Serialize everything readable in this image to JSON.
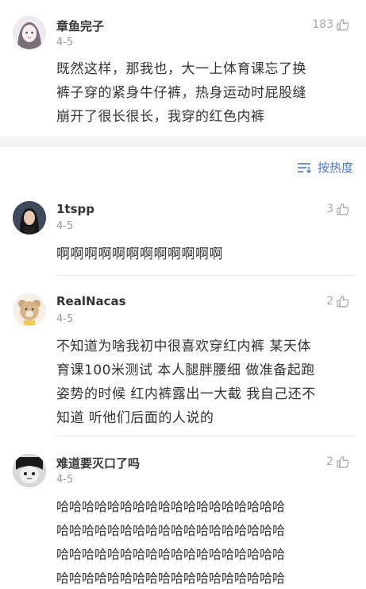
{
  "main_comment": {
    "username": "章鱼完子",
    "date": "4-5",
    "likes": "183",
    "lines": [
      "既然这样，那我也，大一上体育课忘了换",
      "裤子穿的紧身牛仔裤，热身运动时屁股缝",
      "崩开了很长很长，我穿的红色内裤"
    ]
  },
  "sort": {
    "label": "按热度",
    "icon": "sort-icon"
  },
  "replies": [
    {
      "username": "1tspp",
      "date": "4-5",
      "likes": "3",
      "lines": [
        "啊啊啊啊啊啊啊啊啊啊啊啊"
      ]
    },
    {
      "username": "RealNacas",
      "date": "4-5",
      "likes": "2",
      "lines": [
        "不知道为啥我初中很喜欢穿红内裤  某天体",
        "育课100米测试 本人腿胖腰细 做准备起跑",
        "姿势的时候 红内裤露出一大截 我自己还不",
        "知道 听他们后面的人说的"
      ]
    },
    {
      "username": "难道要灭口了吗",
      "date": "4-5",
      "likes": "2",
      "lines": [
        "哈哈哈哈哈哈哈哈哈哈哈哈哈哈哈哈哈哈",
        "哈哈哈哈哈哈哈哈哈哈哈哈哈哈哈哈哈哈",
        "哈哈哈哈哈哈哈哈哈哈哈哈哈哈哈哈哈哈",
        "哈哈哈哈哈哈哈哈哈哈哈哈哈哈哈哈哈哈"
      ]
    }
  ],
  "colors": {
    "accent": "#4a78c9",
    "muted": "#999999",
    "divider": "#f2f2f4"
  }
}
